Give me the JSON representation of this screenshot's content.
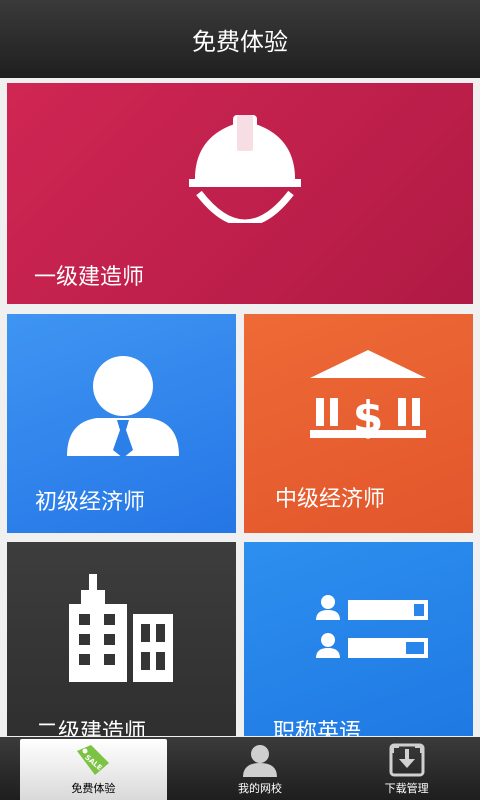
{
  "header": {
    "title": "免费体验"
  },
  "tiles": [
    {
      "label": "一级建造师",
      "icon": "hardhat-icon",
      "color": "#c71f4d"
    },
    {
      "label": "初级经济师",
      "icon": "businessman-icon",
      "color": "#2f84ec"
    },
    {
      "label": "中级经济师",
      "icon": "bank-icon",
      "color": "#e85e30"
    },
    {
      "label": "二级建造师",
      "icon": "buildings-icon",
      "color": "#363636"
    },
    {
      "label": "职称英语",
      "icon": "user-list-icon",
      "color": "#2584ea"
    }
  ],
  "tabbar": {
    "items": [
      {
        "label": "免费体验",
        "icon": "sale-tag-icon",
        "active": true
      },
      {
        "label": "我的网校",
        "icon": "person-icon",
        "active": false
      },
      {
        "label": "下载管理",
        "icon": "download-box-icon",
        "active": false
      }
    ]
  }
}
